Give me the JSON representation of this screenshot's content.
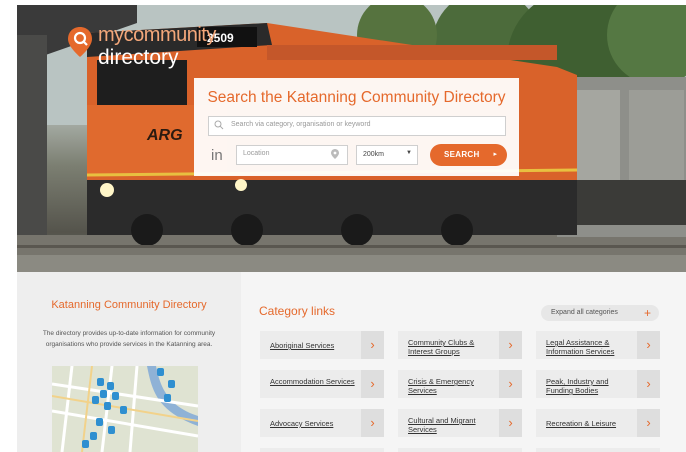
{
  "logo": {
    "line1": "mycommunity",
    "line2": "directory"
  },
  "hero": {
    "locomotive_number": "2509",
    "locomotive_brand": "ARG",
    "search": {
      "title": "Search the Katanning Community Directory",
      "keyword_placeholder": "Search via category, organisation or keyword",
      "in_label": "in",
      "location_placeholder": "Location",
      "distance_value": "200km",
      "search_button": "SEARCH"
    }
  },
  "sidebar": {
    "title": "Katanning Community Directory",
    "description": "The directory provides up-to-date information for community organisations who provide services in the Katanning area."
  },
  "categories": {
    "heading": "Category links",
    "expand_label": "Expand all categories",
    "expand_icon": "+",
    "arrow_icon": "›",
    "items": [
      {
        "label": "Aboriginal Services"
      },
      {
        "label": "Community Clubs & Interest Groups"
      },
      {
        "label": "Legal Assistance & Information Services"
      },
      {
        "label": "Accommodation Services"
      },
      {
        "label": "Crisis & Emergency Services"
      },
      {
        "label": "Peak, Industry and Funding Bodies"
      },
      {
        "label": "Advocacy Services"
      },
      {
        "label": "Cultural and Migrant Services"
      },
      {
        "label": "Recreation & Leisure"
      }
    ]
  },
  "colors": {
    "accent": "#e5692c",
    "panel": "#ececec",
    "arrow_bg": "#dedede"
  }
}
